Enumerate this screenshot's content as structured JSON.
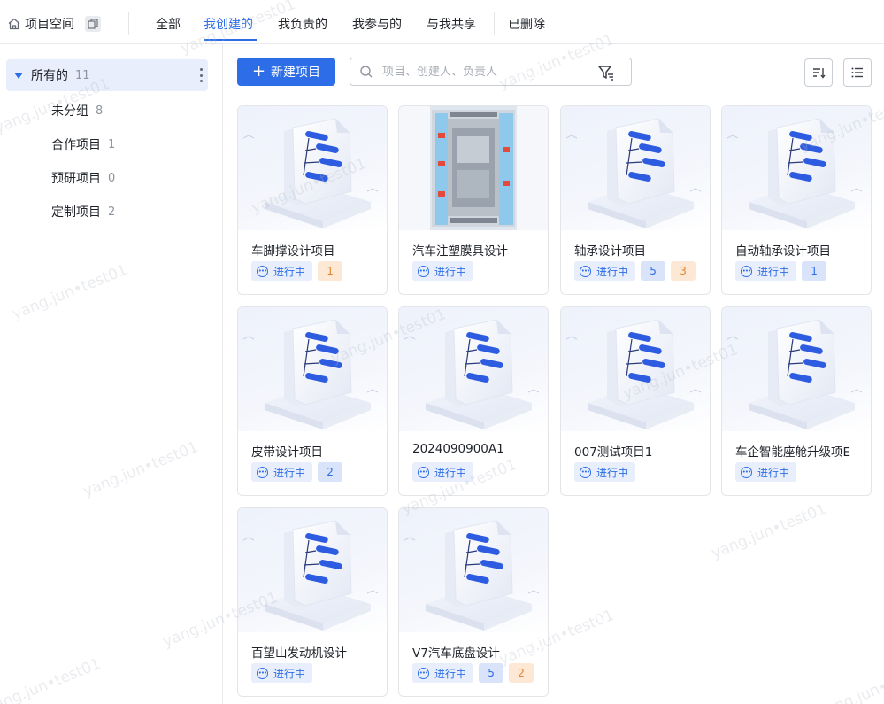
{
  "header": {
    "workspace_label": "项目空间",
    "tabs": [
      {
        "label": "全部"
      },
      {
        "label": "我创建的"
      },
      {
        "label": "我负责的"
      },
      {
        "label": "我参与的"
      },
      {
        "label": "与我共享"
      },
      {
        "label": "已删除"
      }
    ],
    "active_tab": "我创建的"
  },
  "sidebar": {
    "all": {
      "label": "所有的",
      "count": "11"
    },
    "items": [
      {
        "label": "未分组",
        "count": "8"
      },
      {
        "label": "合作项目",
        "count": "1"
      },
      {
        "label": "预研项目",
        "count": "0"
      },
      {
        "label": "定制项目",
        "count": "2"
      }
    ]
  },
  "toolbar": {
    "new_button": "新建项目",
    "search_placeholder": "项目、创建人、负责人"
  },
  "projects": [
    {
      "name": "车脚撑设计项目",
      "status": "进行中",
      "badges": [
        {
          "value": "1",
          "color": "orange"
        }
      ],
      "thumb": "doc"
    },
    {
      "name": "汽车注塑膜具设计",
      "status": "进行中",
      "badges": [],
      "thumb": "photo"
    },
    {
      "name": "轴承设计项目",
      "status": "进行中",
      "badges": [
        {
          "value": "5",
          "color": "blue"
        },
        {
          "value": "3",
          "color": "orange"
        }
      ],
      "thumb": "doc"
    },
    {
      "name": "自动轴承设计项目",
      "status": "进行中",
      "badges": [
        {
          "value": "1",
          "color": "blue"
        }
      ],
      "thumb": "doc"
    },
    {
      "name": "皮带设计项目",
      "status": "进行中",
      "badges": [
        {
          "value": "2",
          "color": "blue"
        }
      ],
      "thumb": "doc"
    },
    {
      "name": "2024090900A1",
      "status": "进行中",
      "badges": [],
      "thumb": "doc"
    },
    {
      "name": "007测试项目1",
      "status": "进行中",
      "badges": [],
      "thumb": "doc"
    },
    {
      "name": "车企智能座舱升级项E",
      "status": "进行中",
      "badges": [],
      "thumb": "doc"
    },
    {
      "name": "百望山发动机设计",
      "status": "进行中",
      "badges": [],
      "thumb": "doc"
    },
    {
      "name": "V7汽车底盘设计",
      "status": "进行中",
      "badges": [
        {
          "value": "5",
          "color": "blue"
        },
        {
          "value": "2",
          "color": "orange"
        }
      ],
      "thumb": "doc"
    }
  ],
  "watermark": "yang.jun•test01",
  "colors": {
    "accent": "#2d6ee8",
    "badge_orange": "#e2852e"
  }
}
